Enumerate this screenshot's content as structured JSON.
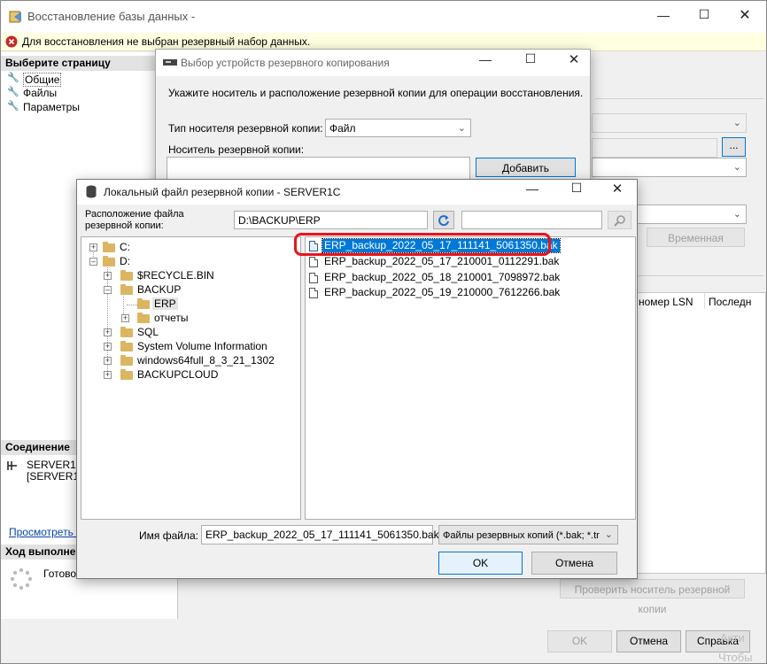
{
  "main": {
    "title": "Восстановление базы данных -",
    "error": "Для восстановления не выбран резервный набор данных.",
    "select_page": "Выберите страницу",
    "pages": [
      "Общие",
      "Файлы",
      "Параметры"
    ],
    "connection_header": "Соединение",
    "server1": "SERVER1C",
    "server2": "[SERVER1C",
    "view_link": "Просмотреть с",
    "progress_header": "Ход выполнени",
    "progress_status": "Готово",
    "browse_btn": "...",
    "timeline_btn": "Временная",
    "col_lsn": "номер LSN",
    "col_last": "Последн",
    "verify_btn": "Проверить носитель резервной копии",
    "ok": "OK",
    "cancel": "Отмена",
    "help": "Справка",
    "watermark1": "Акти",
    "watermark2": "Чтобы"
  },
  "devices": {
    "title": "Выбор устройств резервного копирования",
    "instruction": "Укажите носитель и расположение резервной копии для операции восстановления.",
    "media_type_label": "Тип носителя резервной копии:",
    "media_type_value": "Файл",
    "media_label": "Носитель резервной копии:",
    "add_btn": "Добавить"
  },
  "local": {
    "title": "Локальный файл резервной копии - SERVER1C",
    "location_label_1": "Расположение файла",
    "location_label_2": "резервной копии:",
    "path": "D:\\BACKUP\\ERP",
    "search_value": "",
    "tree": {
      "c": "C:",
      "d": "D:",
      "recycle": "$RECYCLE.BIN",
      "backup": "BACKUP",
      "erp": "ERP",
      "reports": "отчеты",
      "sql": "SQL",
      "svi": "System Volume Information",
      "win": "windows64full_8_3_21_1302",
      "cloud": "BACKUPCLOUD"
    },
    "files": [
      "ERP_backup_2022_05_17_111141_5061350.bak",
      "ERP_backup_2022_05_17_210001_0112291.bak",
      "ERP_backup_2022_05_18_210001_7098972.bak",
      "ERP_backup_2022_05_19_210000_7612266.bak"
    ],
    "filename_label": "Имя файла:",
    "filename_value": "ERP_backup_2022_05_17_111141_5061350.bak",
    "filter": "Файлы резервных копий (*.bak; *.tr",
    "ok": "OK",
    "cancel": "Отмена"
  }
}
